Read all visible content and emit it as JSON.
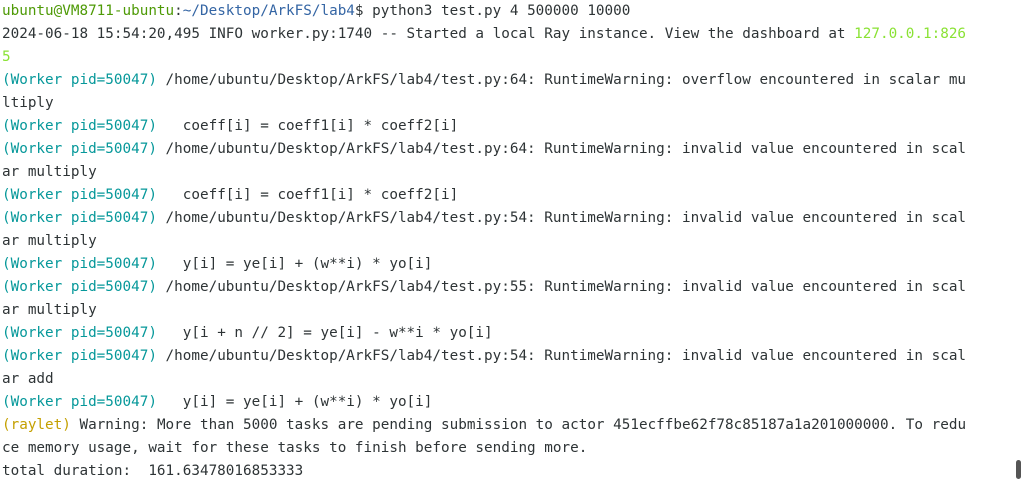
{
  "prompt": {
    "user_host": "ubuntu@VM8711-ubuntu",
    "sep": ":",
    "cwd": "~/Desktop/ArkFS/lab4",
    "symbol": "$",
    "command": " python3 test.py 4 500000 10000"
  },
  "info_line": {
    "text": "2024-06-18 15:54:20,495 INFO worker.py:1740 -- Started a local Ray instance. View the dashboard at ",
    "url_part1": "127.0.0.1:826",
    "url_part2": "5"
  },
  "worker_prefix": "(Worker pid=50047)",
  "lines": [
    " /home/ubuntu/Desktop/ArkFS/lab4/test.py:64: RuntimeWarning: overflow encountered in scalar mu",
    "ltiply",
    "   coeff[i] = coeff1[i] * coeff2[i]",
    " /home/ubuntu/Desktop/ArkFS/lab4/test.py:64: RuntimeWarning: invalid value encountered in scal",
    "ar multiply",
    "   coeff[i] = coeff1[i] * coeff2[i]",
    " /home/ubuntu/Desktop/ArkFS/lab4/test.py:54: RuntimeWarning: invalid value encountered in scal",
    "ar multiply",
    "   y[i] = ye[i] + (w**i) * yo[i]",
    " /home/ubuntu/Desktop/ArkFS/lab4/test.py:55: RuntimeWarning: invalid value encountered in scal",
    "ar multiply",
    "   y[i + n // 2] = ye[i] - w**i * yo[i]",
    " /home/ubuntu/Desktop/ArkFS/lab4/test.py:54: RuntimeWarning: invalid value encountered in scal",
    "ar add",
    "   y[i] = ye[i] + (w**i) * yo[i]"
  ],
  "raylet": {
    "prefix": "(raylet)",
    "text1": " Warning: More than 5000 tasks are pending submission to actor 451ecffbe62f78c85187a1a201000000. To redu",
    "text2": "ce memory usage, wait for these tasks to finish before sending more."
  },
  "total_duration": "total duration:  161.63478016853333"
}
